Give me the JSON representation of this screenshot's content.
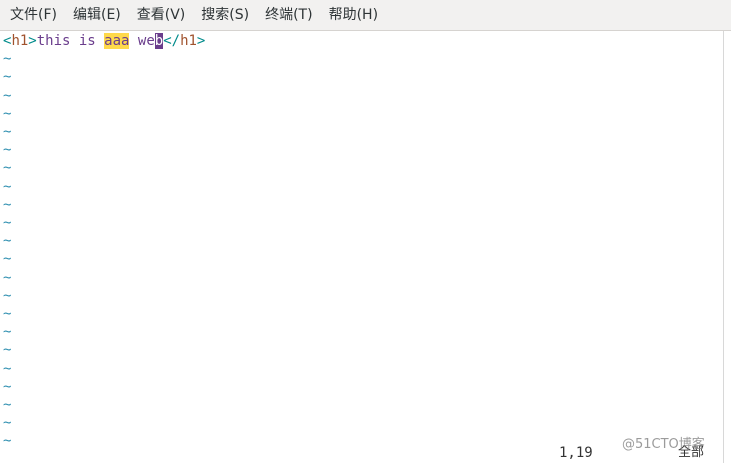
{
  "menubar": {
    "items": [
      {
        "label": "文件(F)"
      },
      {
        "label": "编辑(E)"
      },
      {
        "label": "查看(V)"
      },
      {
        "label": "搜索(S)"
      },
      {
        "label": "终端(T)"
      },
      {
        "label": "帮助(H)"
      }
    ]
  },
  "editor": {
    "line1": {
      "open_lt": "<",
      "open_tag": "h1",
      "open_gt": ">",
      "text_before": "this is ",
      "match": "aaa",
      "text_mid": " we",
      "cursor_char": "b",
      "close_lt": "</",
      "close_tag": "h1",
      "close_gt": ">"
    },
    "empty_line_marker": "~",
    "empty_line_count": 22
  },
  "status": {
    "position": "1,19",
    "scroll": "全部"
  },
  "watermark": "@51CTO博客",
  "colors": {
    "tag_bracket": "#008b8b",
    "tag_name": "#a0522d",
    "text": "#6a3d8c",
    "search_highlight": "#ffd94a",
    "cursor_bg": "#6a3d8c",
    "tilde": "#2f8fb0"
  }
}
